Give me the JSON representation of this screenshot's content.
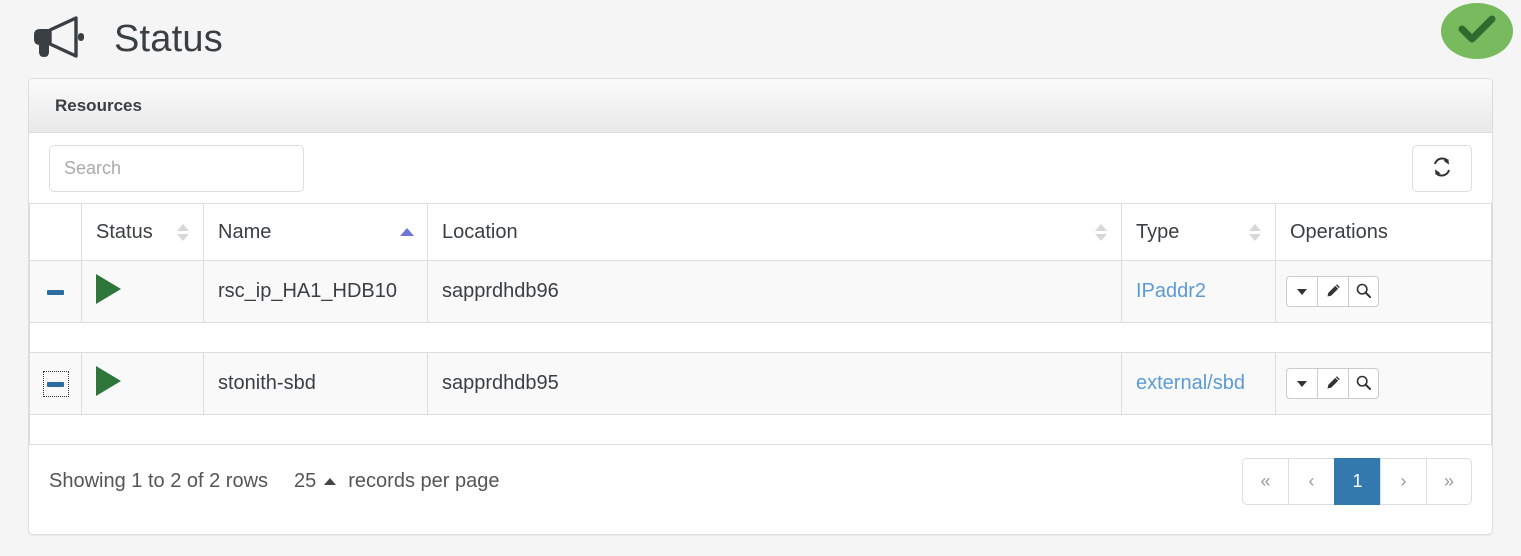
{
  "header": {
    "icon": "megaphone-icon",
    "title": "Status",
    "badge": {
      "icon": "check-icon",
      "color": "#77bb5e"
    }
  },
  "panel": {
    "title": "Resources",
    "toolbar": {
      "search_placeholder": "Search",
      "search_value": "",
      "refresh_icon": "refresh-icon"
    },
    "table": {
      "columns": [
        {
          "label": "",
          "sort": "none"
        },
        {
          "label": "Status",
          "sort": "both"
        },
        {
          "label": "Name",
          "sort": "asc"
        },
        {
          "label": "Location",
          "sort": "both"
        },
        {
          "label": "Type",
          "sort": "both"
        },
        {
          "label": "Operations",
          "sort": "none"
        }
      ],
      "rows": [
        {
          "toggle": {
            "icon": "minus-icon",
            "focused": false
          },
          "status_icon": "play-icon",
          "name": "rsc_ip_HA1_HDB10",
          "location": "sapprdhdb96",
          "type": "IPaddr2",
          "operations": [
            "caret-down-icon",
            "pencil-icon",
            "magnifier-icon"
          ]
        },
        {
          "toggle": {
            "icon": "minus-icon",
            "focused": true
          },
          "status_icon": "play-icon",
          "name": "stonith-sbd",
          "location": "sapprdhdb95",
          "type": "external/sbd",
          "operations": [
            "caret-down-icon",
            "pencil-icon",
            "magnifier-icon"
          ]
        }
      ]
    },
    "footer": {
      "showing_text": "Showing 1 to 2 of 2 rows",
      "page_size": "25",
      "records_text": "records per page",
      "pagination": {
        "first": "«",
        "prev": "‹",
        "pages": [
          "1"
        ],
        "next": "›",
        "last": "»",
        "active": "1"
      }
    }
  }
}
